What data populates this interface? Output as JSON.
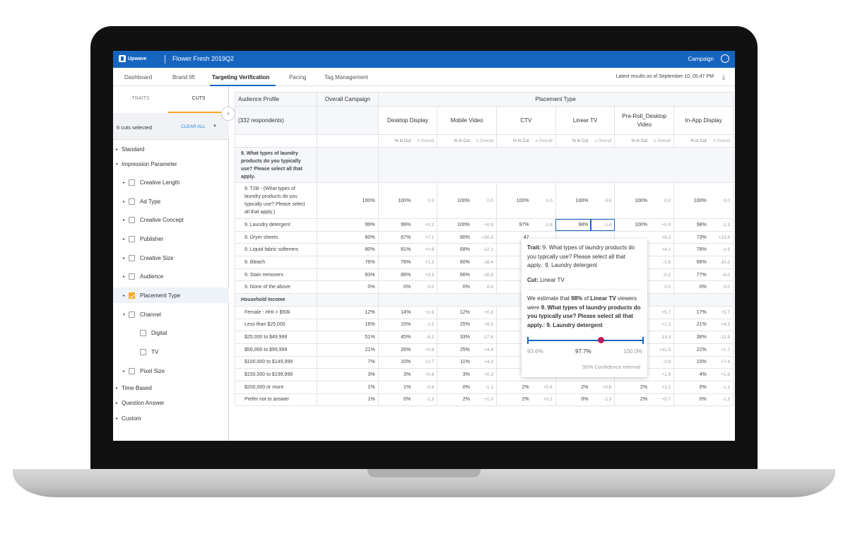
{
  "topbar": {
    "logo": "Upwave",
    "project": "Flower Fresh 2019Q2",
    "campaign": "Campaign"
  },
  "nav": {
    "tabs": [
      "Dashboard",
      "Brand lift",
      "Targeting Verification",
      "Pacing",
      "Tag Management"
    ],
    "active_index": 2,
    "latest": "Latest results as of September 10, 05:47 PM"
  },
  "sidebar": {
    "tabs": [
      "TRAITS",
      "CUTS"
    ],
    "cuts_selected": "6 cuts selected",
    "clear_all": "CLEAR ALL",
    "tree": [
      {
        "label": "Standard",
        "level": 0,
        "arrow": "▸",
        "checkbox": false,
        "checked": false
      },
      {
        "label": "Impression Parameter",
        "level": 0,
        "arrow": "▾",
        "checkbox": false,
        "checked": false
      },
      {
        "label": "Creative Length",
        "level": 1,
        "arrow": "▸",
        "checkbox": true,
        "checked": false
      },
      {
        "label": "Ad Type",
        "level": 1,
        "arrow": "▸",
        "checkbox": true,
        "checked": false
      },
      {
        "label": "Creative Concept",
        "level": 1,
        "arrow": "▸",
        "checkbox": true,
        "checked": false
      },
      {
        "label": "Publisher",
        "level": 1,
        "arrow": "▸",
        "checkbox": true,
        "checked": false
      },
      {
        "label": "Creative Size",
        "level": 1,
        "arrow": "▸",
        "checkbox": true,
        "checked": false
      },
      {
        "label": "Audience",
        "level": 1,
        "arrow": "▸",
        "checkbox": true,
        "checked": false
      },
      {
        "label": "Placement Type",
        "level": 1,
        "arrow": "▸",
        "checkbox": true,
        "checked": true
      },
      {
        "label": "Channel",
        "level": 1,
        "arrow": "▾",
        "checkbox": true,
        "checked": false
      },
      {
        "label": "Digital",
        "level": 2,
        "arrow": "",
        "checkbox": true,
        "checked": false
      },
      {
        "label": "TV",
        "level": 2,
        "arrow": "",
        "checkbox": true,
        "checked": false
      },
      {
        "label": "Pixel Size",
        "level": 1,
        "arrow": "▸",
        "checkbox": true,
        "checked": false
      },
      {
        "label": "Time-Based",
        "level": 0,
        "arrow": "▸",
        "checkbox": false,
        "checked": false
      },
      {
        "label": "Question Answer",
        "level": 0,
        "arrow": "▸",
        "checkbox": false,
        "checked": false
      },
      {
        "label": "Custom",
        "level": 0,
        "arrow": "▸",
        "checkbox": false,
        "checked": false
      }
    ]
  },
  "table": {
    "audience_profile": "Audience Profile",
    "overall_campaign": "Overall Campaign",
    "placement_type": "Placement Type",
    "respondents": "(332 respondents)",
    "placements": [
      "Desktop Display",
      "Mobile Video",
      "CTV",
      "Linear TV",
      "Pre-Roll_Desktop Video",
      "In-App Display"
    ],
    "sub_pct": "% in Cut",
    "sub_delta": "± Overall",
    "question_header": "9. What types of laundry products do you typically use? Please select all that apply.",
    "t2b": {
      "label": "9. T2B - (What types of laundry products do you typically use? Please select all that apply.)",
      "overall": "100%",
      "cells": [
        [
          "100%",
          "0.0"
        ],
        [
          "100%",
          "0.0"
        ],
        [
          "100%",
          "0.0"
        ],
        [
          "100%",
          "0.0"
        ],
        [
          "100%",
          "0.0"
        ],
        [
          "100%",
          "0.0"
        ]
      ]
    },
    "rows1": [
      {
        "label": "9. Laundry detergent",
        "overall": "99%",
        "cells": [
          [
            "99%",
            "+0.2"
          ],
          [
            "100%",
            "+0.9"
          ],
          [
            "97%",
            "-1.6"
          ],
          [
            "98%",
            "-1.4"
          ],
          [
            "100%",
            "+0.9"
          ],
          [
            "98%",
            "-1.3"
          ]
        ]
      },
      {
        "label": "9. Dryer sheets",
        "overall": "60%",
        "cells": [
          [
            "67%",
            "+7.1"
          ],
          [
            "90%",
            "+30.3"
          ],
          [
            "47",
            ""
          ],
          [
            "",
            ""
          ],
          [
            "",
            "+6.2"
          ],
          [
            "73%",
            "+13.8"
          ]
        ]
      },
      {
        "label": "9. Liquid fabric softeners",
        "overall": "80%",
        "cells": [
          [
            "81%",
            "+0.8"
          ],
          [
            "68%",
            "-12.1"
          ],
          [
            "87",
            ""
          ],
          [
            "",
            ""
          ],
          [
            "",
            "+4.1"
          ],
          [
            "78%",
            "-1.9"
          ]
        ]
      },
      {
        "label": "9. Bleach",
        "overall": "76%",
        "cells": [
          [
            "78%",
            "+1.5"
          ],
          [
            "60%",
            "-16.4"
          ],
          [
            "79",
            ""
          ],
          [
            "",
            ""
          ],
          [
            "",
            "-1.6"
          ],
          [
            "66%",
            "-10.3"
          ]
        ]
      },
      {
        "label": "9. Stain removers",
        "overall": "83%",
        "cells": [
          [
            "86%",
            "+3.3"
          ],
          [
            "66%",
            "-16.9"
          ],
          [
            "87",
            ""
          ],
          [
            "",
            ""
          ],
          [
            "",
            "-0.2"
          ],
          [
            "77%",
            "-6.0"
          ]
        ]
      },
      {
        "label": "9. None of the above",
        "overall": "0%",
        "cells": [
          [
            "0%",
            "0.0"
          ],
          [
            "0%",
            "0.0"
          ],
          [
            "0",
            ""
          ],
          [
            "",
            ""
          ],
          [
            "",
            "0.0"
          ],
          [
            "0%",
            "0.0"
          ]
        ]
      }
    ],
    "household_income": "Household Income",
    "rows2": [
      {
        "label": "Female - HHI > $50k",
        "overall": "12%",
        "cells": [
          [
            "14%",
            "+2.6"
          ],
          [
            "12%",
            "+0.8"
          ],
          [
            "6",
            ""
          ],
          [
            "",
            ""
          ],
          [
            "",
            "+5.7"
          ],
          [
            "17%",
            "+5.7"
          ]
        ]
      },
      {
        "label": "Less than $25,000",
        "overall": "16%",
        "cells": [
          [
            "15%",
            "-1.0"
          ],
          [
            "25%",
            "+8.5"
          ],
          [
            "18",
            ""
          ],
          [
            "",
            ""
          ],
          [
            "",
            "+1.3"
          ],
          [
            "21%",
            "+4.3"
          ]
        ]
      },
      {
        "label": "$25,000 to $49,999",
        "overall": "51%",
        "cells": [
          [
            "45%",
            "-6.2"
          ],
          [
            "33%",
            "-17.8"
          ],
          [
            "62",
            ""
          ],
          [
            "",
            ""
          ],
          [
            "",
            "-13.3"
          ],
          [
            "38%",
            "-12.9"
          ]
        ]
      },
      {
        "label": "$50,000 to $99,999",
        "overall": "21%",
        "cells": [
          [
            "26%",
            "+5.8"
          ],
          [
            "25%",
            "+4.8"
          ],
          [
            "11",
            ""
          ],
          [
            "",
            ""
          ],
          [
            "",
            "+11.0"
          ],
          [
            "22%",
            "+1.7"
          ]
        ]
      },
      {
        "label": "$100,000 to $149,999",
        "overall": "7%",
        "cells": [
          [
            "10%",
            "+2.7"
          ],
          [
            "11%",
            "+4.3"
          ],
          [
            "4",
            ""
          ],
          [
            "",
            ""
          ],
          [
            "",
            "-2.8"
          ],
          [
            "15%",
            "+7.4"
          ]
        ]
      },
      {
        "label": "$150,000 to $199,999",
        "overall": "3%",
        "cells": [
          [
            "3%",
            "+0.6"
          ],
          [
            "3%",
            "+0.3"
          ],
          [
            "0%",
            "-2.6"
          ],
          [
            "0%",
            "-2.6"
          ],
          [
            "4%",
            "+1.9"
          ],
          [
            "4%",
            "+1.9"
          ]
        ]
      },
      {
        "label": "$200,000 or more",
        "overall": "1%",
        "cells": [
          [
            "1%",
            "-0.6"
          ],
          [
            "0%",
            "-1.1"
          ],
          [
            "2%",
            "+0.8"
          ],
          [
            "2%",
            "+0.6"
          ],
          [
            "2%",
            "+1.2"
          ],
          [
            "0%",
            "-1.1"
          ]
        ]
      },
      {
        "label": "Prefer not to answer",
        "overall": "1%",
        "cells": [
          [
            "0%",
            "-1.3"
          ],
          [
            "2%",
            "+1.0"
          ],
          [
            "2%",
            "+0.2"
          ],
          [
            "0%",
            "-1.3"
          ],
          [
            "2%",
            "+0.7"
          ],
          [
            "0%",
            "-1.3"
          ]
        ]
      }
    ]
  },
  "tooltip": {
    "trait_label": "Trait:",
    "trait_text": "9. What types of laundry products do you typically use? Please select all that apply.: 9. Laundry detergent",
    "cut_label": "Cut:",
    "cut_text": "Linear TV",
    "estimate_pre": "We estimate that",
    "estimate_pct": "98%",
    "estimate_of": "of",
    "estimate_group": "Linear TV",
    "estimate_viewers": "viewers were",
    "estimate_question": "9. What types of laundry products do you typically use? Please select all that apply.: 9. Laundry detergent",
    "ci_low": "93.6%",
    "ci_mid": "97.7%",
    "ci_high": "100.0%",
    "ci_value": 0.977,
    "ci_label": "95% Confidence Interval"
  },
  "colors": {
    "brand": "#1565c0",
    "accent": "#f5a623",
    "point": "#c2185b"
  }
}
